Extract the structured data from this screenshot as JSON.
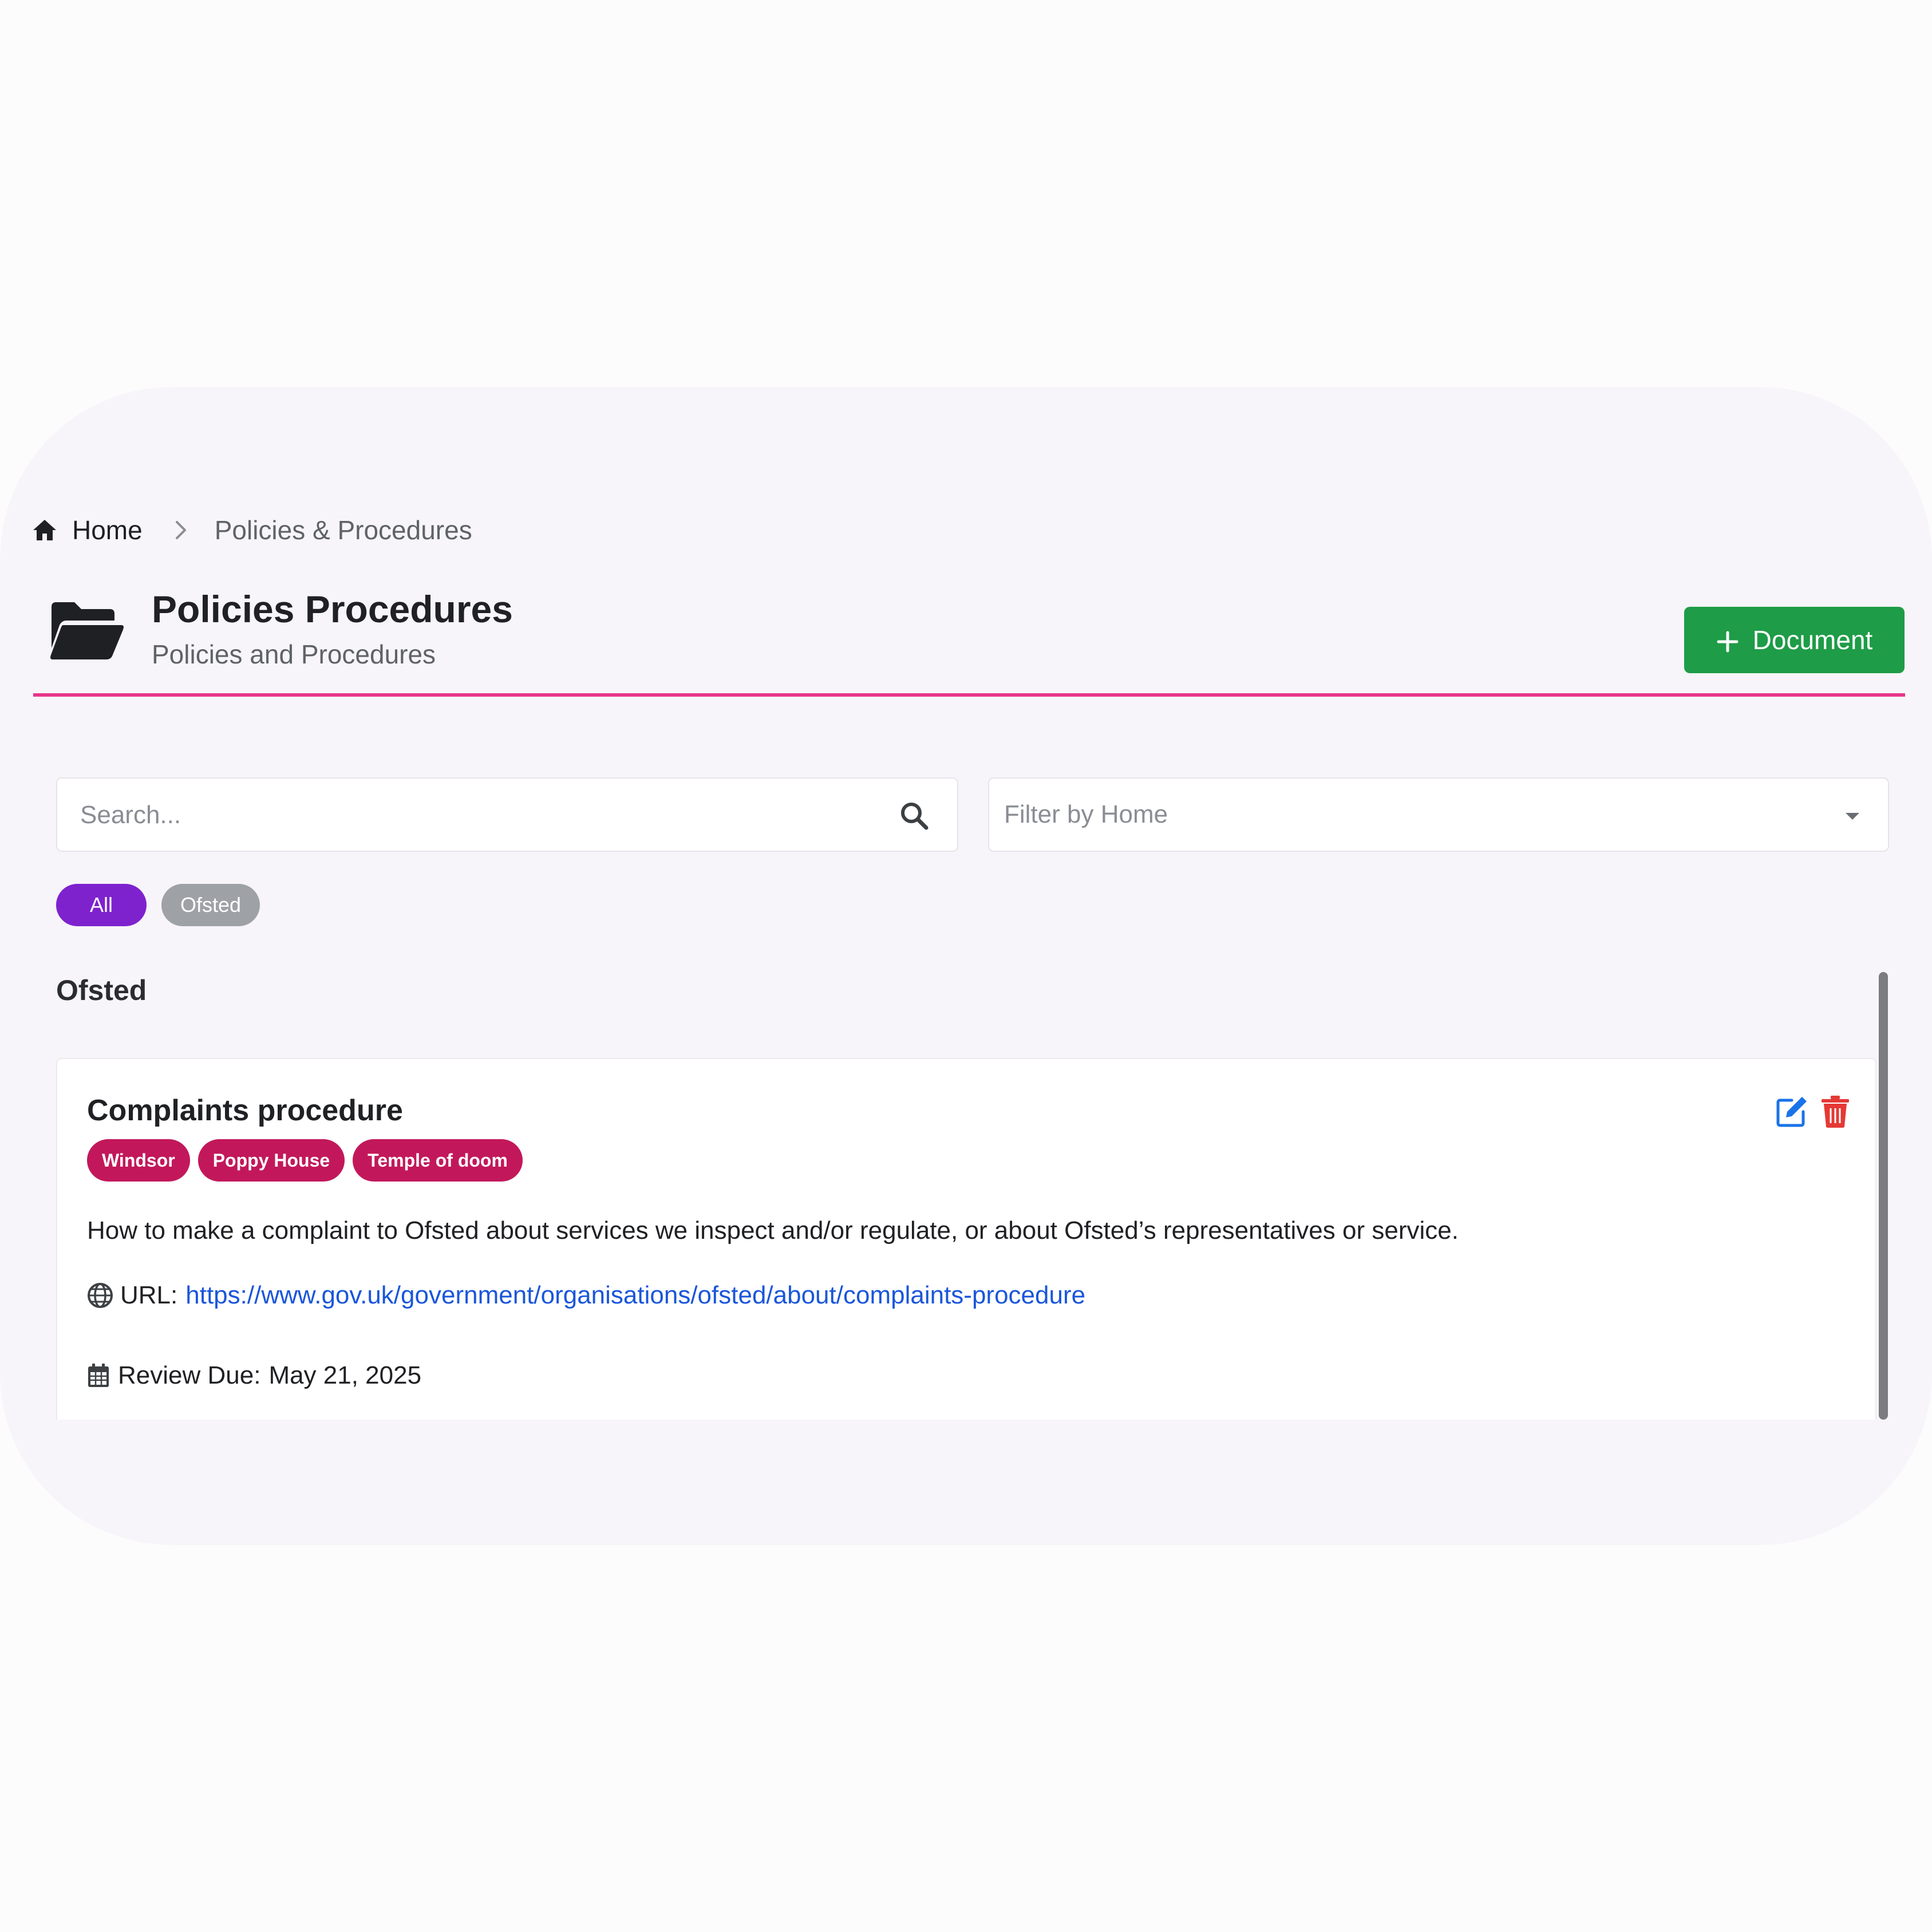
{
  "breadcrumb": {
    "home_label": "Home",
    "current_label": "Policies & Procedures"
  },
  "header": {
    "title": "Policies Procedures",
    "subtitle": "Policies and Procedures",
    "add_button_label": "Document",
    "accent_color": "#e8358a",
    "button_color": "#1e9c47"
  },
  "search": {
    "placeholder": "Search...",
    "value": ""
  },
  "filter": {
    "placeholder": "Filter by Home"
  },
  "categories": [
    {
      "label": "All",
      "active": true,
      "color": "#7e22ce"
    },
    {
      "label": "Ofsted",
      "active": false,
      "color": "#9ea1a6"
    }
  ],
  "section": {
    "title": "Ofsted"
  },
  "document": {
    "title": "Complaints procedure",
    "tags": [
      "Windsor",
      "Poppy House",
      "Temple of doom"
    ],
    "tag_color": "#c2185b",
    "description": "How to make a complaint to Ofsted about services we inspect and/or regulate, or about Ofsted’s representatives or service.",
    "url_label": "URL:",
    "url": "https://www.gov.uk/government/organisations/ofsted/about/complaints-procedure",
    "review_label": "Review Due:",
    "review_date": "May 21, 2025"
  }
}
